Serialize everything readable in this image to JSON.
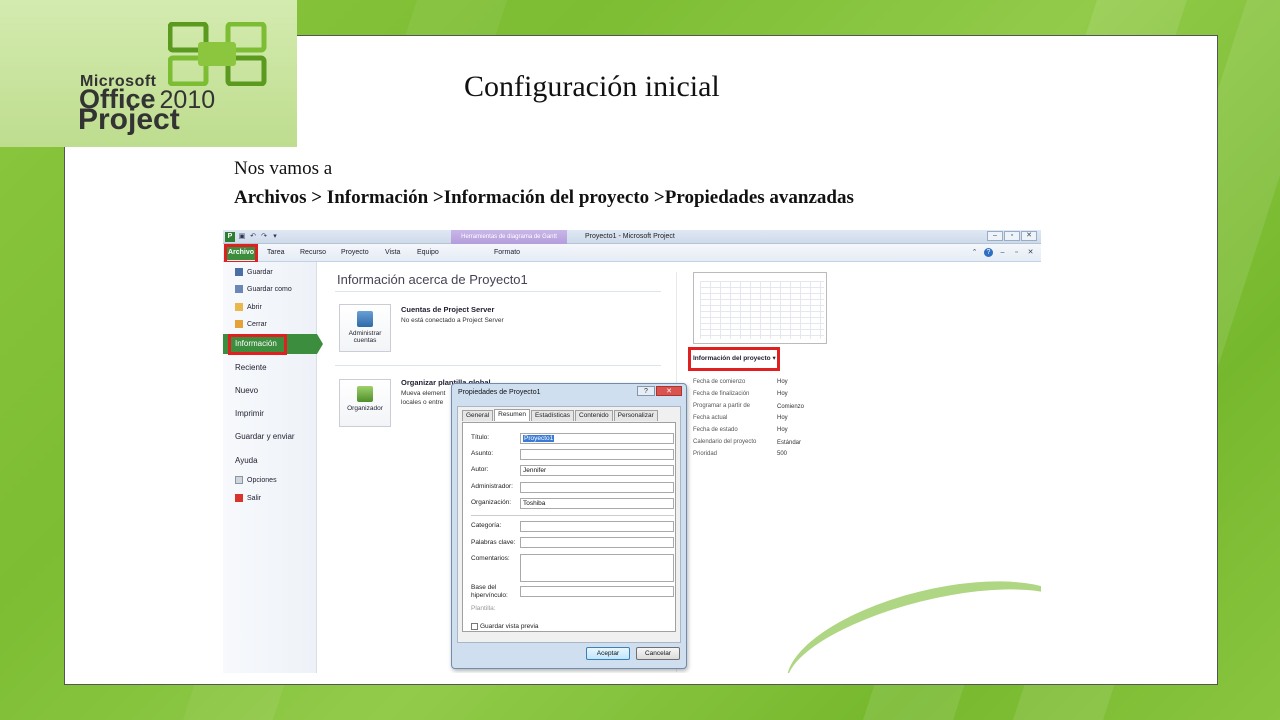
{
  "slide": {
    "title": "Configuración inicial",
    "subtitle_line1": "Nos vamos a",
    "subtitle_line2": "Archivos > Información >Información del proyecto >Propiedades avanzadas"
  },
  "logo": {
    "brand_line1": "Microsoft",
    "brand_line2": "Office",
    "brand_year": "2010",
    "product": "Project"
  },
  "app": {
    "window_title": "Proyecto1 - Microsoft Project",
    "context_tab_group": "Herramientas de diagrama de Gantt",
    "ribbon_tabs": [
      "Archivo",
      "Tarea",
      "Recurso",
      "Proyecto",
      "Vista",
      "Equipo",
      "Formato"
    ],
    "backstage": {
      "small_items": [
        "Guardar",
        "Guardar como",
        "Abrir",
        "Cerrar"
      ],
      "selected": "Información",
      "big_items": [
        "Reciente",
        "Nuevo",
        "Imprimir",
        "Guardar y enviar",
        "Ayuda"
      ],
      "bottom_items": [
        "Opciones",
        "Salir"
      ]
    },
    "info": {
      "heading": "Información acerca de Proyecto1",
      "tile1_label": "Administrar cuentas",
      "section1_title": "Cuentas de Project Server",
      "section1_text": "No está conectado a Project Server",
      "tile2_label": "Organizador",
      "section2_title": "Organizar plantilla global",
      "section2_text_line1": "Mueva element",
      "section2_text_line2": "locales o entre"
    },
    "project_info": {
      "label": "Información del proyecto",
      "rows": [
        {
          "label": "Fecha de comienzo",
          "value": "Hoy"
        },
        {
          "label": "Fecha de finalización",
          "value": "Hoy"
        },
        {
          "label": "Programar a partir de",
          "value": "Comienzo"
        },
        {
          "label": "Fecha actual",
          "value": "Hoy"
        },
        {
          "label": "Fecha de estado",
          "value": "Hoy"
        },
        {
          "label": "Calendario del proyecto",
          "value": "Estándar"
        },
        {
          "label": "Prioridad",
          "value": "500"
        }
      ]
    }
  },
  "dialog": {
    "title": "Propiedades de Proyecto1",
    "help_btn": "?",
    "close_btn": "✕",
    "tabs": [
      "General",
      "Resumen",
      "Estadísticas",
      "Contenido",
      "Personalizar"
    ],
    "active_tab": "Resumen",
    "fields": {
      "titulo_label": "Título:",
      "titulo_value": "Proyecto1",
      "asunto_label": "Asunto:",
      "asunto_value": "",
      "autor_label": "Autor:",
      "autor_value": "Jennifer",
      "admin_label": "Administrador:",
      "admin_value": "",
      "org_label": "Organización:",
      "org_value": "Toshiba",
      "cat_label": "Categoría:",
      "cat_value": "",
      "keys_label": "Palabras clave:",
      "keys_value": "",
      "comm_label": "Comentarios:",
      "comm_value": "",
      "base_label_1": "Base del",
      "base_label_2": "hipervínculo:",
      "base_value": "",
      "plantilla_label": "Plantilla:"
    },
    "checkbox_label": "Guardar vista previa",
    "ok_label": "Aceptar",
    "cancel_label": "Cancelar"
  },
  "colors": {
    "background_green": "#8cc63f",
    "archivo_green": "#3d8d3f",
    "highlight_red": "#e02020",
    "context_purple": "#b49ddb"
  }
}
